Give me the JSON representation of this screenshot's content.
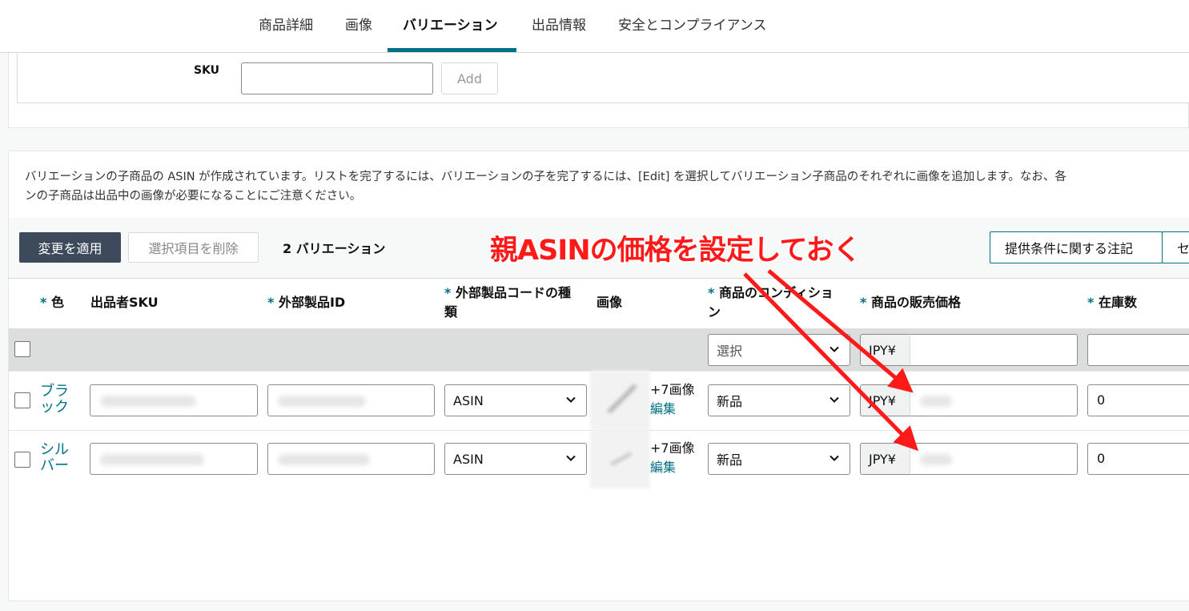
{
  "tabs": [
    {
      "label": "商品詳細",
      "active": false
    },
    {
      "label": "画像",
      "active": false
    },
    {
      "label": "バリエーション",
      "active": true
    },
    {
      "label": "出品情報",
      "active": false
    },
    {
      "label": "安全とコンプライアンス",
      "active": false
    }
  ],
  "sku_section": {
    "label": "SKU",
    "input_value": "",
    "add_label": "Add"
  },
  "info": {
    "line1": "バリエーションの子商品の ASIN が作成されています。リストを完了するには、バリエーションの子を完了するには、[Edit] を選択してバリエーション子商品のそれぞれに画像を追加します。なお、各",
    "line2": "ンの子商品は出品中の画像が必要になることにご注意ください。"
  },
  "toolbar": {
    "apply_label": "変更を適用",
    "delete_label": "選択項目を削除",
    "variation_count": "2 バリエーション",
    "offer_notes_label": "提供条件に関する注記",
    "next_label": "セ"
  },
  "table": {
    "headers": {
      "color": "色",
      "seller_sku": "出品者SKU",
      "external_id": "外部製品ID",
      "external_code_type_l1": "外部製品コードの種",
      "external_code_type_l2": "類",
      "image": "画像",
      "condition_l1": "商品のコンディショ",
      "condition_l2": "ン",
      "price": "商品の販売価格",
      "quantity": "在庫数"
    },
    "required_mark": "*",
    "filter_row": {
      "condition_placeholder": "選択",
      "currency": "JPY¥",
      "price": "",
      "quantity": ""
    },
    "rows": [
      {
        "color_l1": "ブラ",
        "color_l2": "ック",
        "id_type": "ASIN",
        "image_count": "+7画像",
        "edit_label": "編集",
        "condition": "新品",
        "currency": "JPY¥",
        "quantity": "0"
      },
      {
        "color_l1": "シル",
        "color_l2": "バー",
        "id_type": "ASIN",
        "image_count": "+7画像",
        "edit_label": "編集",
        "condition": "新品",
        "currency": "JPY¥",
        "quantity": "0"
      }
    ]
  },
  "annotation": {
    "text": "親ASINの価格を設定しておく",
    "color": "#ff1a1a"
  },
  "colors": {
    "accent": "#007185",
    "dark_button": "#3d4a5c",
    "filter_row": "#dcdede"
  }
}
